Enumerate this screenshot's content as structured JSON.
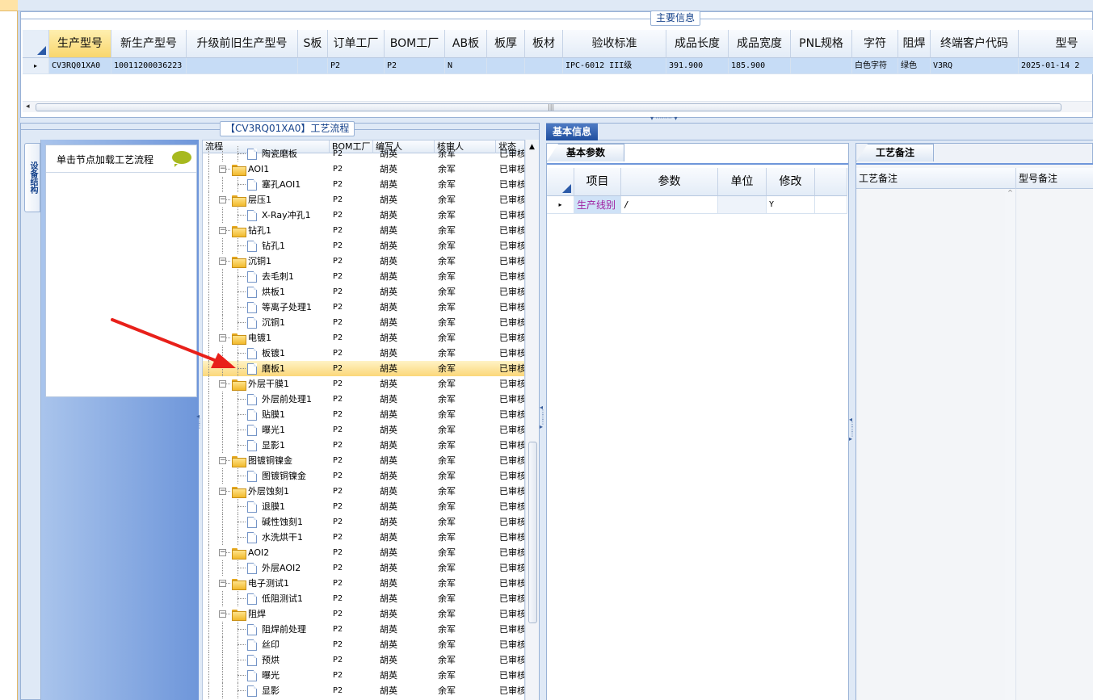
{
  "main_panel": {
    "title": "主要信息",
    "columns": [
      "生产型号",
      "新生产型号",
      "升级前旧生产型号",
      "S板",
      "订单工厂",
      "BOM工厂",
      "AB板",
      "板厚",
      "板材",
      "验收标准",
      "成品长度",
      "成品宽度",
      "PNL规格",
      "字符",
      "阻焊",
      "终端客户代码",
      "型号"
    ],
    "row": [
      "CV3RQ01XA0",
      "10011200036223",
      "",
      "",
      "P2",
      "P2",
      "N",
      "",
      "",
      "IPC-6012 III级",
      "391.900",
      "185.900",
      "",
      "白色字符",
      "绿色",
      "V3RQ",
      "2025-01-14 2"
    ],
    "row_indicator": "▸"
  },
  "left_panel": {
    "title": "【CV3RQ01XA0】工艺流程",
    "vertical_tab": "设备结构",
    "node_hint": "单击节点加载工艺流程",
    "tree_columns": [
      "流程",
      "BOM工厂",
      "编写人",
      "核审人",
      "状态"
    ],
    "tree_rows": [
      {
        "name": "陶瓷磨板",
        "level": 2,
        "type": "doc",
        "bom": "P2",
        "writer": "胡英",
        "reviewer": "余军",
        "status": "已审核",
        "partial": true
      },
      {
        "name": "AOI1",
        "level": 1,
        "type": "folder",
        "bom": "P2",
        "writer": "胡英",
        "reviewer": "余军",
        "status": "已审核"
      },
      {
        "name": "塞孔AOI1",
        "level": 2,
        "type": "doc",
        "bom": "P2",
        "writer": "胡英",
        "reviewer": "余军",
        "status": "已审核"
      },
      {
        "name": "层压1",
        "level": 1,
        "type": "folder",
        "bom": "P2",
        "writer": "胡英",
        "reviewer": "余军",
        "status": "已审核"
      },
      {
        "name": "X-Ray冲孔1",
        "level": 2,
        "type": "doc",
        "bom": "P2",
        "writer": "胡英",
        "reviewer": "余军",
        "status": "已审核"
      },
      {
        "name": "钻孔1",
        "level": 1,
        "type": "folder",
        "bom": "P2",
        "writer": "胡英",
        "reviewer": "余军",
        "status": "已审核"
      },
      {
        "name": "钻孔1",
        "level": 2,
        "type": "doc",
        "bom": "P2",
        "writer": "胡英",
        "reviewer": "余军",
        "status": "已审核"
      },
      {
        "name": "沉铜1",
        "level": 1,
        "type": "folder",
        "bom": "P2",
        "writer": "胡英",
        "reviewer": "余军",
        "status": "已审核"
      },
      {
        "name": "去毛刺1",
        "level": 2,
        "type": "doc",
        "bom": "P2",
        "writer": "胡英",
        "reviewer": "余军",
        "status": "已审核"
      },
      {
        "name": "烘板1",
        "level": 2,
        "type": "doc",
        "bom": "P2",
        "writer": "胡英",
        "reviewer": "余军",
        "status": "已审核"
      },
      {
        "name": "等离子处理1",
        "level": 2,
        "type": "doc",
        "bom": "P2",
        "writer": "胡英",
        "reviewer": "余军",
        "status": "已审核"
      },
      {
        "name": "沉铜1",
        "level": 2,
        "type": "doc",
        "bom": "P2",
        "writer": "胡英",
        "reviewer": "余军",
        "status": "已审核"
      },
      {
        "name": "电镀1",
        "level": 1,
        "type": "folder",
        "bom": "P2",
        "writer": "胡英",
        "reviewer": "余军",
        "status": "已审核"
      },
      {
        "name": "板镀1",
        "level": 2,
        "type": "doc",
        "bom": "P2",
        "writer": "胡英",
        "reviewer": "余军",
        "status": "已审核"
      },
      {
        "name": "磨板1",
        "level": 2,
        "type": "doc",
        "bom": "P2",
        "writer": "胡英",
        "reviewer": "余军",
        "status": "已审核",
        "selected": true
      },
      {
        "name": "外层干膜1",
        "level": 1,
        "type": "folder",
        "bom": "P2",
        "writer": "胡英",
        "reviewer": "余军",
        "status": "已审核"
      },
      {
        "name": "外层前处理1",
        "level": 2,
        "type": "doc",
        "bom": "P2",
        "writer": "胡英",
        "reviewer": "余军",
        "status": "已审核"
      },
      {
        "name": "贴膜1",
        "level": 2,
        "type": "doc",
        "bom": "P2",
        "writer": "胡英",
        "reviewer": "余军",
        "status": "已审核"
      },
      {
        "name": "曝光1",
        "level": 2,
        "type": "doc",
        "bom": "P2",
        "writer": "胡英",
        "reviewer": "余军",
        "status": "已审核"
      },
      {
        "name": "显影1",
        "level": 2,
        "type": "doc",
        "bom": "P2",
        "writer": "胡英",
        "reviewer": "余军",
        "status": "已审核"
      },
      {
        "name": "图镀铜镍金",
        "level": 1,
        "type": "folder",
        "bom": "P2",
        "writer": "胡英",
        "reviewer": "余军",
        "status": "已审核"
      },
      {
        "name": "图镀铜镍金",
        "level": 2,
        "type": "doc",
        "bom": "P2",
        "writer": "胡英",
        "reviewer": "余军",
        "status": "已审核"
      },
      {
        "name": "外层蚀刻1",
        "level": 1,
        "type": "folder",
        "bom": "P2",
        "writer": "胡英",
        "reviewer": "余军",
        "status": "已审核"
      },
      {
        "name": "退膜1",
        "level": 2,
        "type": "doc",
        "bom": "P2",
        "writer": "胡英",
        "reviewer": "余军",
        "status": "已审核"
      },
      {
        "name": "碱性蚀刻1",
        "level": 2,
        "type": "doc",
        "bom": "P2",
        "writer": "胡英",
        "reviewer": "余军",
        "status": "已审核"
      },
      {
        "name": "水洗烘干1",
        "level": 2,
        "type": "doc",
        "bom": "P2",
        "writer": "胡英",
        "reviewer": "余军",
        "status": "已审核"
      },
      {
        "name": "AOI2",
        "level": 1,
        "type": "folder",
        "bom": "P2",
        "writer": "胡英",
        "reviewer": "余军",
        "status": "已审核"
      },
      {
        "name": "外层AOI2",
        "level": 2,
        "type": "doc",
        "bom": "P2",
        "writer": "胡英",
        "reviewer": "余军",
        "status": "已审核"
      },
      {
        "name": "电子测试1",
        "level": 1,
        "type": "folder",
        "bom": "P2",
        "writer": "胡英",
        "reviewer": "余军",
        "status": "已审核"
      },
      {
        "name": "低阻测试1",
        "level": 2,
        "type": "doc",
        "bom": "P2",
        "writer": "胡英",
        "reviewer": "余军",
        "status": "已审核"
      },
      {
        "name": "阻焊",
        "level": 1,
        "type": "folder",
        "bom": "P2",
        "writer": "胡英",
        "reviewer": "余军",
        "status": "已审核"
      },
      {
        "name": "阻焊前处理",
        "level": 2,
        "type": "doc",
        "bom": "P2",
        "writer": "胡英",
        "reviewer": "余军",
        "status": "已审核"
      },
      {
        "name": "丝印",
        "level": 2,
        "type": "doc",
        "bom": "P2",
        "writer": "胡英",
        "reviewer": "余军",
        "status": "已审核"
      },
      {
        "name": "预烘",
        "level": 2,
        "type": "doc",
        "bom": "P2",
        "writer": "胡英",
        "reviewer": "余军",
        "status": "已审核"
      },
      {
        "name": "曝光",
        "level": 2,
        "type": "doc",
        "bom": "P2",
        "writer": "胡英",
        "reviewer": "余军",
        "status": "已审核"
      },
      {
        "name": "显影",
        "level": 2,
        "type": "doc",
        "bom": "P2",
        "writer": "胡英",
        "reviewer": "余军",
        "status": "已审核"
      }
    ]
  },
  "right_panel": {
    "tab": "基本信息",
    "params_tab": "基本参数",
    "params_columns": [
      "项目",
      "参数",
      "单位",
      "修改"
    ],
    "params_row": {
      "item": "生产线别",
      "param": "/",
      "unit": "",
      "modify": "Y"
    },
    "notes_tab": "工艺备注",
    "notes_columns": [
      "工艺备注",
      "型号备注"
    ]
  },
  "colors": {
    "accent": "#15428b",
    "selected_row": "#fbd779",
    "annotation_arrow": "#e8201a",
    "item_text": "#a020a0"
  }
}
